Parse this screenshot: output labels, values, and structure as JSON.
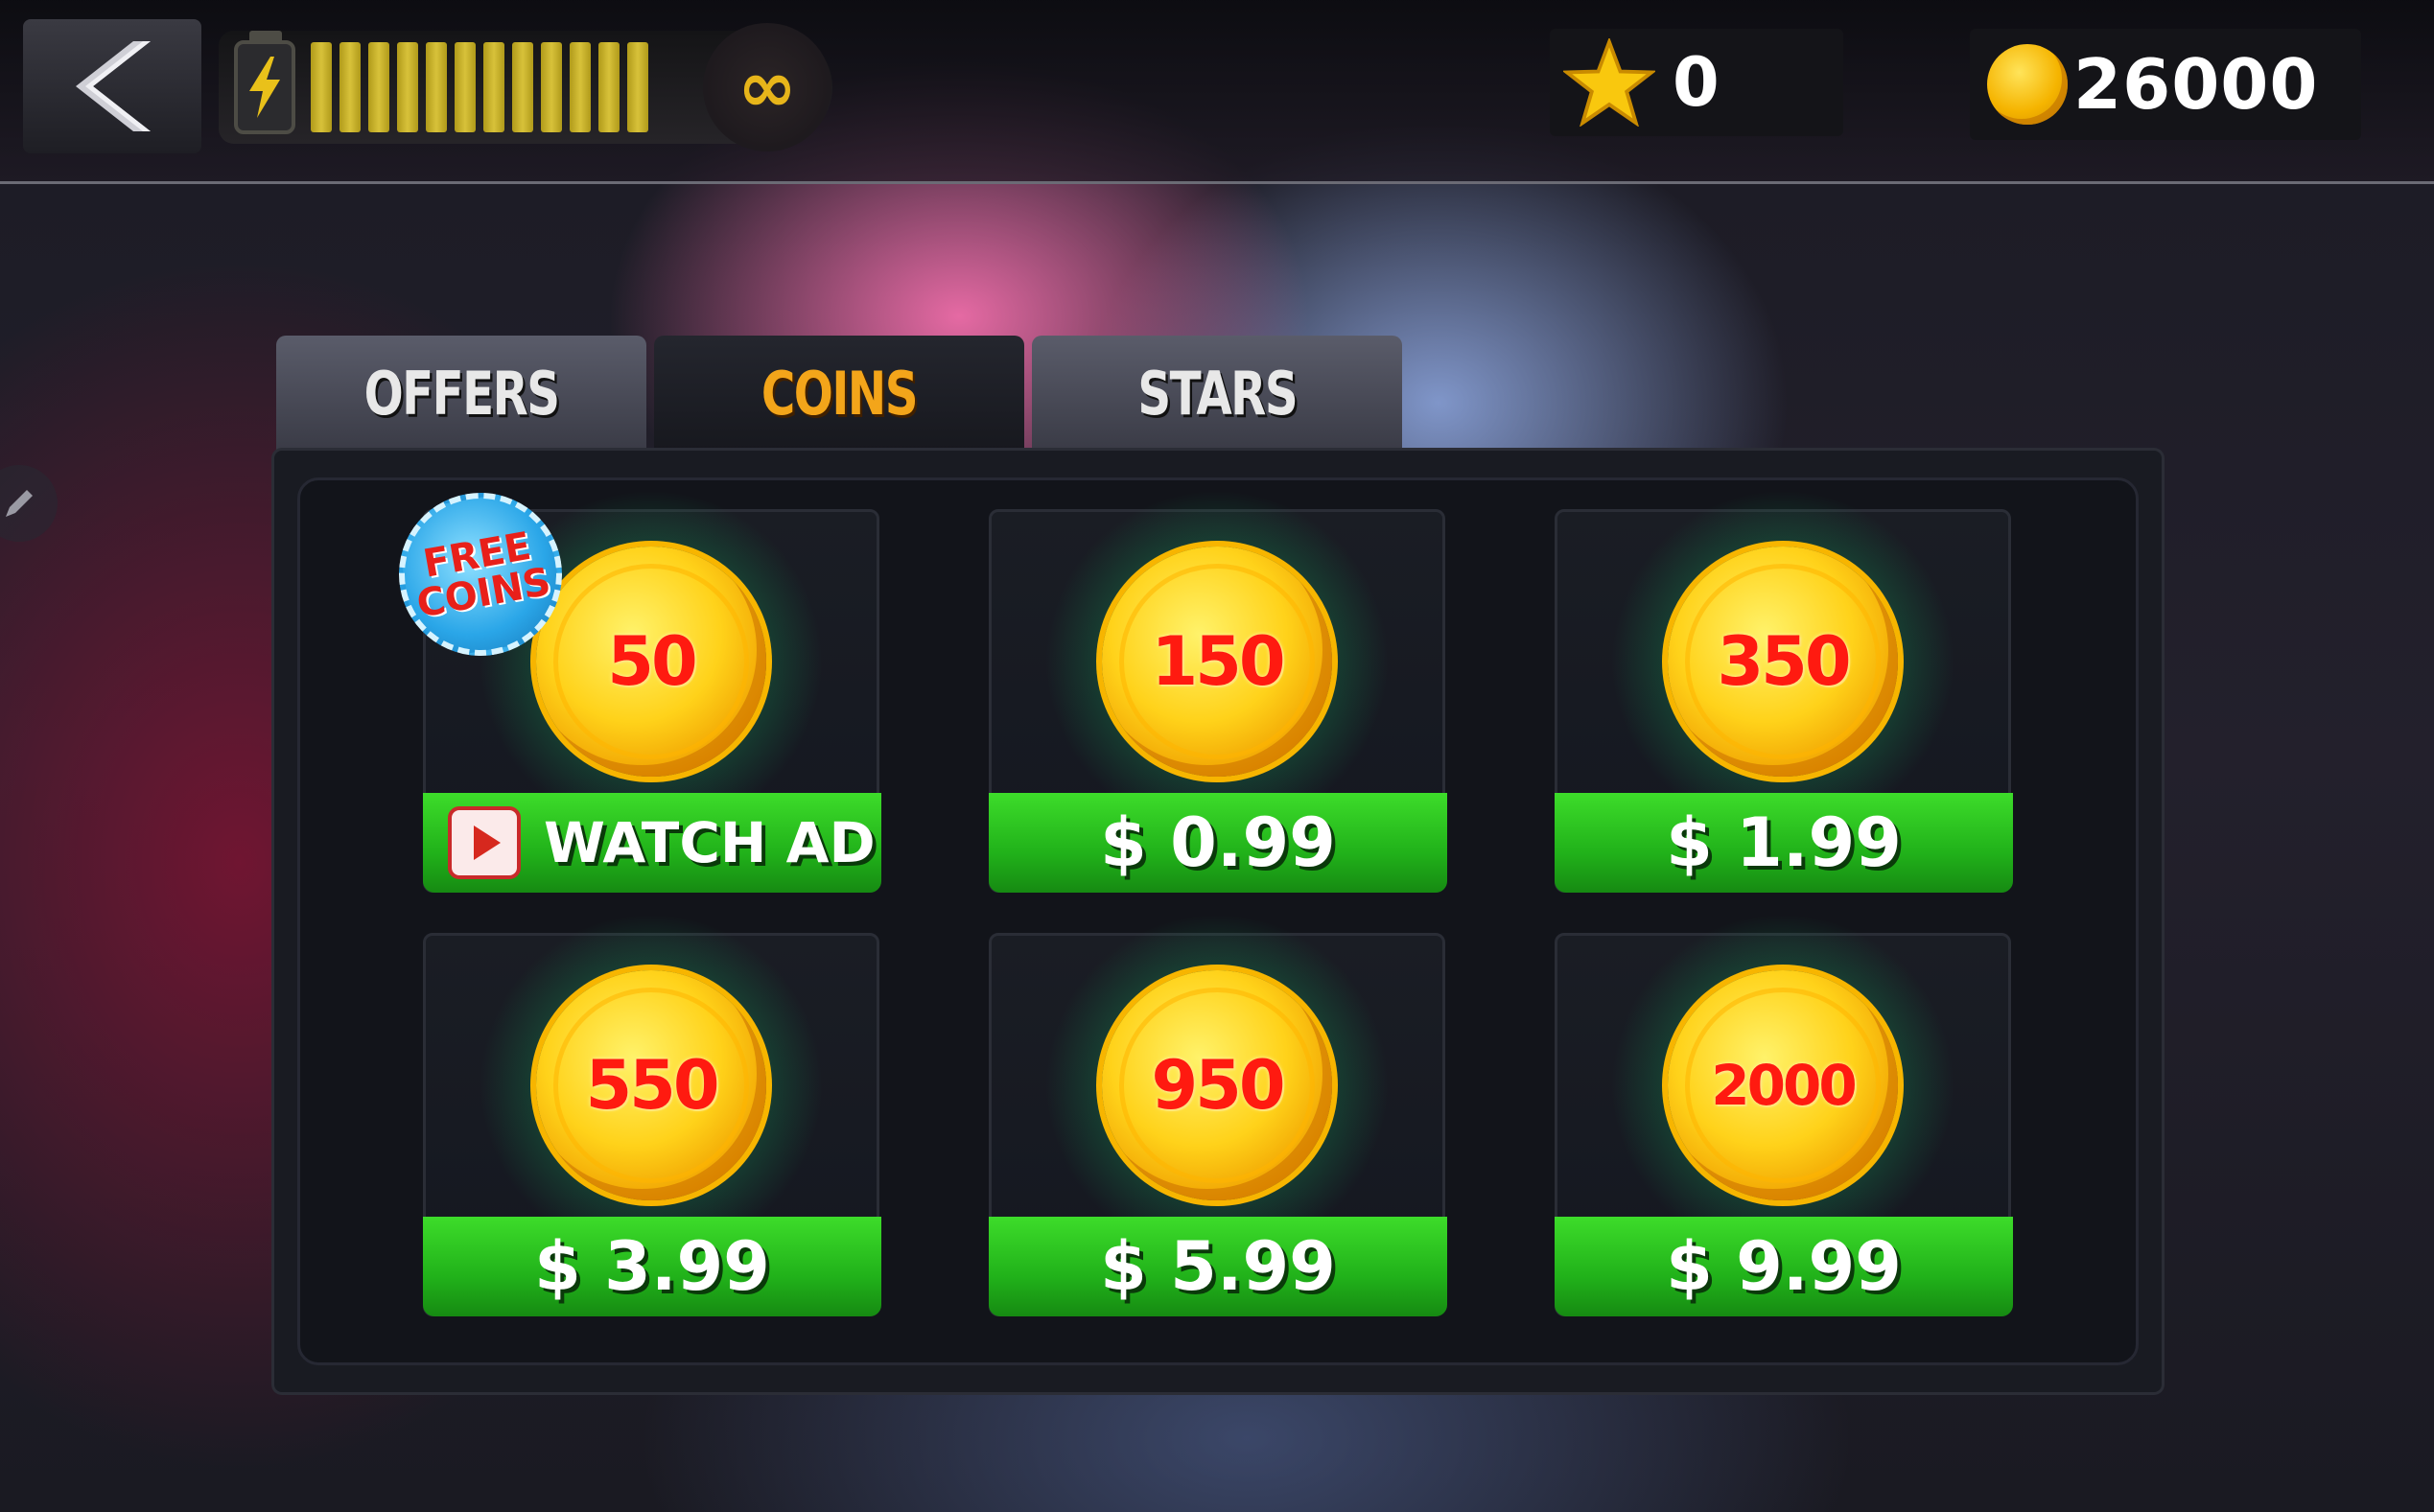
{
  "topbar": {
    "energy_bars": 12,
    "energy_icon": "lightning-icon",
    "infinity_symbol": "∞",
    "stars_count": "0",
    "coins_count": "26000"
  },
  "tabs": [
    {
      "label": "OFFERS",
      "active": false
    },
    {
      "label": "COINS",
      "active": true
    },
    {
      "label": "STARS",
      "active": false
    }
  ],
  "packs": [
    {
      "amount": "50",
      "price": "WATCH AD",
      "badge_line1": "FREE",
      "badge_line2": "COINS"
    },
    {
      "amount": "150",
      "price": "$ 0.99"
    },
    {
      "amount": "350",
      "price": "$ 1.99"
    },
    {
      "amount": "550",
      "price": "$ 3.99"
    },
    {
      "amount": "950",
      "price": "$ 5.99"
    },
    {
      "amount": "2000",
      "price": "$ 9.99"
    }
  ],
  "colors": {
    "active_tab_text": "#f3a51a",
    "buy_button": "#21b21a",
    "coin_amount": "#ff1a10",
    "badge": "#2aa6e8"
  }
}
